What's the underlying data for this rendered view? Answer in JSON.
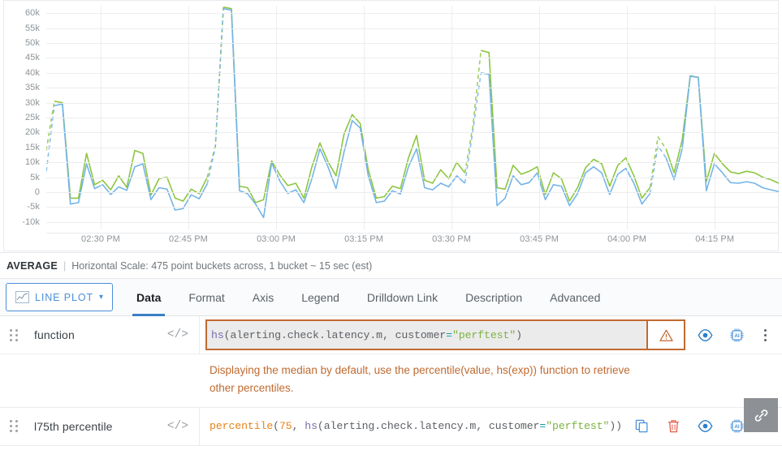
{
  "chart_data": {
    "type": "line",
    "title": "",
    "xlabel": "",
    "ylabel": "",
    "ylim": [
      -12500,
      62500
    ],
    "grid": true,
    "legend_position": "none",
    "y_ticks": [
      "60k",
      "55k",
      "50k",
      "45k",
      "40k",
      "35k",
      "30k",
      "25k",
      "20k",
      "15k",
      "10k",
      "5k",
      "0",
      "-5k",
      "-10k"
    ],
    "y_tick_values": [
      60000,
      55000,
      50000,
      45000,
      40000,
      35000,
      30000,
      25000,
      20000,
      15000,
      10000,
      5000,
      0,
      -5000,
      -10000
    ],
    "x_ticks": [
      "02:30 PM",
      "02:45 PM",
      "03:00 PM",
      "03:15 PM",
      "03:30 PM",
      "03:45 PM",
      "04:00 PM",
      "04:15 PM"
    ],
    "series": [
      {
        "name": "function",
        "color": "#8dc63f",
        "values": [
          14000,
          30500,
          30000,
          -2000,
          -2000,
          13000,
          2500,
          4000,
          800,
          5500,
          1600,
          14000,
          13000,
          -1000,
          4500,
          5000,
          -2000,
          -3000,
          1000,
          -500,
          5000,
          15500,
          62000,
          61500,
          2000,
          1500,
          -3500,
          -2500,
          10500,
          5800,
          2200,
          3000,
          -2000,
          8500,
          16500,
          10200,
          5500,
          19500,
          26000,
          23000,
          7500,
          -2000,
          -1500,
          2000,
          1200,
          11500,
          19000,
          4000,
          3000,
          7500,
          4500,
          10000,
          6500,
          22000,
          47500,
          46800,
          1500,
          1000,
          9000,
          6000,
          7000,
          8500,
          -800,
          6500,
          4500,
          -3000,
          1500,
          8200,
          11000,
          9500,
          2000,
          9000,
          11500,
          5500,
          -2000,
          1500,
          18500,
          14500,
          6500,
          17500,
          39000,
          38500,
          3500,
          13000,
          9500,
          6800,
          6200,
          7000,
          6500,
          5000,
          4200,
          3000
        ]
      },
      {
        "name": "75th percentile",
        "color": "#74b4e8",
        "values": [
          7000,
          29000,
          29500,
          -4000,
          -3500,
          9500,
          1200,
          2500,
          -800,
          1800,
          600,
          8500,
          9500,
          -2500,
          1500,
          1000,
          -6000,
          -5500,
          -900,
          -2200,
          2800,
          15000,
          61500,
          61000,
          500,
          -500,
          -4000,
          -8500,
          9800,
          3800,
          -400,
          800,
          -3500,
          4500,
          14500,
          8500,
          1200,
          13500,
          24000,
          21500,
          5500,
          -3500,
          -3000,
          500,
          -600,
          8500,
          14500,
          1500,
          800,
          3000,
          1800,
          5500,
          3000,
          20500,
          40000,
          39500,
          -4500,
          -2000,
          5500,
          2500,
          3200,
          6500,
          -2500,
          2500,
          2000,
          -4500,
          -500,
          6500,
          8500,
          6500,
          -800,
          6000,
          8000,
          3000,
          -4000,
          -500,
          15500,
          11500,
          4200,
          14500,
          38800,
          38500,
          500,
          9500,
          6500,
          3200,
          3000,
          3500,
          3000,
          1500,
          800,
          200
        ]
      }
    ]
  },
  "status": {
    "aggregation": "AVERAGE",
    "separator": "|",
    "scale_text": "Horizontal Scale: 475 point buckets across, 1 bucket ~ 15 sec (est)"
  },
  "toolbar": {
    "plot_type_label": "LINE PLOT",
    "plot_type_icon": "line-chart-icon",
    "chevron": "⌄",
    "tabs": [
      {
        "label": "Data",
        "active": true
      },
      {
        "label": "Format",
        "active": false
      },
      {
        "label": "Axis",
        "active": false
      },
      {
        "label": "Legend",
        "active": false
      },
      {
        "label": "Drilldown Link",
        "active": false
      },
      {
        "label": "Description",
        "active": false
      },
      {
        "label": "Advanced",
        "active": false
      }
    ]
  },
  "rows": [
    {
      "name": "function",
      "code_icon": "</>",
      "has_warning": true,
      "expression_text": "hs(alerting.check.latency.m, customer=\"perftest\")",
      "tokens": [
        {
          "t": "hs",
          "c": "tk-fn"
        },
        {
          "t": "(alerting.check.latency.m, customer",
          "c": "tk-txt"
        },
        {
          "t": "=",
          "c": "tk-eq"
        },
        {
          "t": "\"perftest\"",
          "c": "tk-str"
        },
        {
          "t": ")",
          "c": "tk-txt"
        }
      ],
      "warning_message": "Displaying the median by default, use the percentile(value, hs(exp)) function to retrieve other percentiles."
    },
    {
      "name": "l75th percentile",
      "code_icon": "</>",
      "has_warning": false,
      "expression_text": "percentile(75, hs(alerting.check.latency.m, customer=\"perftest\"))",
      "tokens": [
        {
          "t": "percentile",
          "c": "tk-fn2"
        },
        {
          "t": "(",
          "c": "tk-txt"
        },
        {
          "t": "75",
          "c": "tk-num"
        },
        {
          "t": ", ",
          "c": "tk-txt"
        },
        {
          "t": "hs",
          "c": "tk-fn"
        },
        {
          "t": "(alerting.check.latency.m, customer",
          "c": "tk-txt"
        },
        {
          "t": "=",
          "c": "tk-eq"
        },
        {
          "t": "\"perftest\"",
          "c": "tk-str"
        },
        {
          "t": "))",
          "c": "tk-txt"
        }
      ],
      "warning_message": ""
    }
  ],
  "actions": {
    "warning": "warning-triangle-icon",
    "duplicate": "duplicate-icon",
    "delete": "trash-icon",
    "visibility": "eye-icon",
    "ai": "ai-chip-icon",
    "more": "kebab-menu-icon"
  },
  "link_fab": {
    "icon": "chain-link-icon"
  },
  "colors": {
    "series_green": "#8dc63f",
    "series_blue": "#74b4e8",
    "accent_blue": "#4a90d9",
    "warning_orange": "#c06a30",
    "danger_red": "#e05c4a"
  }
}
